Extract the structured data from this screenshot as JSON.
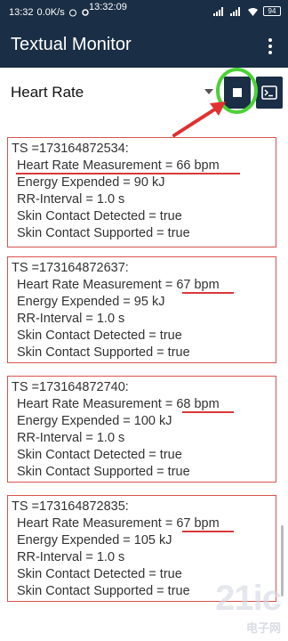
{
  "status_bar": {
    "time": "13:32",
    "speed": "0.0K/s",
    "overlay_time": "13:32:09",
    "battery": "94"
  },
  "app_bar": {
    "title": "Textual Monitor"
  },
  "toolbar": {
    "selected_sensor": "Heart Rate"
  },
  "records": [
    {
      "ts": "TS =173164872534:",
      "heart_rate": "Heart Rate Measurement = 66 bpm",
      "energy": "Energy Expended = 90 kJ",
      "rr": "RR-Interval = 1.0 s",
      "contact_detected": "Skin Contact Detected = true",
      "contact_supported": "Skin Contact Supported = true"
    },
    {
      "ts": "TS =173164872637:",
      "heart_rate": "Heart Rate Measurement = 67 bpm",
      "energy": "Energy Expended = 95 kJ",
      "rr": "RR-Interval = 1.0 s",
      "contact_detected": "Skin Contact Detected = true",
      "contact_supported": "Skin Contact Supported = true"
    },
    {
      "ts": "TS =173164872740:",
      "heart_rate": "Heart Rate Measurement = 68 bpm",
      "energy": "Energy Expended = 100 kJ",
      "rr": "RR-Interval = 1.0 s",
      "contact_detected": "Skin Contact Detected = true",
      "contact_supported": "Skin Contact Supported = true"
    },
    {
      "ts": "TS =173164872835:",
      "heart_rate": "Heart Rate Measurement = 67 bpm",
      "energy": "Energy Expended = 105 kJ",
      "rr": "RR-Interval = 1.0 s",
      "contact_detected": "Skin Contact Detected = true",
      "contact_supported": "Skin Contact Supported = true"
    }
  ],
  "watermark": {
    "text": "21ic",
    "sub": "电子网"
  },
  "colors": {
    "app_bar": "#1a2e45",
    "highlight_circle": "#4cd137",
    "record_border": "#d9534f",
    "annotation": "#e03030"
  },
  "icons": {
    "stop": "stop-icon",
    "console": "terminal-icon",
    "menu": "more-vert-icon",
    "dropdown": "arrow-drop-down-icon"
  }
}
